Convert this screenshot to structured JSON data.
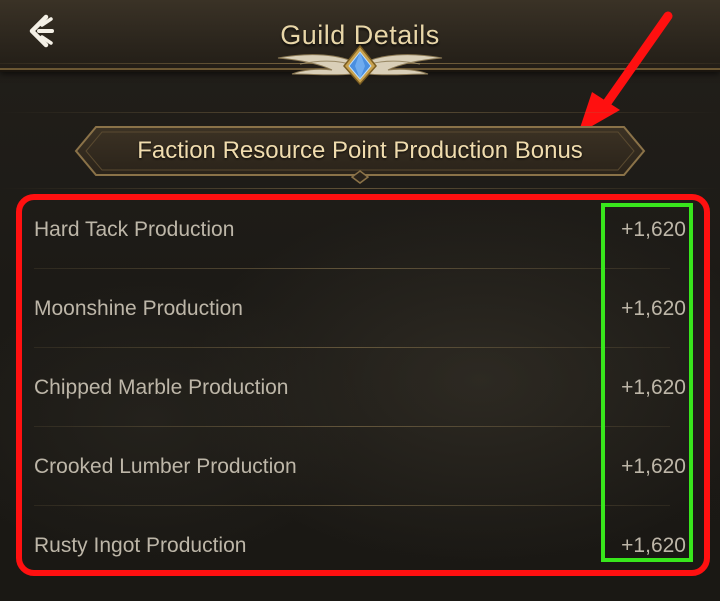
{
  "header": {
    "title": "Guild Details",
    "back_icon": "back-arrow-icon"
  },
  "section": {
    "banner_title": "Faction Resource Point Production Bonus"
  },
  "bonuses": [
    {
      "label": "Hard Tack Production",
      "value": "+1,620"
    },
    {
      "label": "Moonshine Production",
      "value": "+1,620"
    },
    {
      "label": "Chipped Marble Production",
      "value": "+1,620"
    },
    {
      "label": "Crooked Lumber Production",
      "value": "+1,620"
    },
    {
      "label": "Rusty Ingot Production",
      "value": "+1,620"
    }
  ],
  "annotations": {
    "arrow_color": "#ff1010",
    "table_outline_color": "#ff1010",
    "values_outline_color": "#38e61c"
  },
  "colors": {
    "title_gold": "#e8d6a8",
    "text_muted": "#bdb6a8",
    "emblem_gem": "#4a8fe0"
  }
}
